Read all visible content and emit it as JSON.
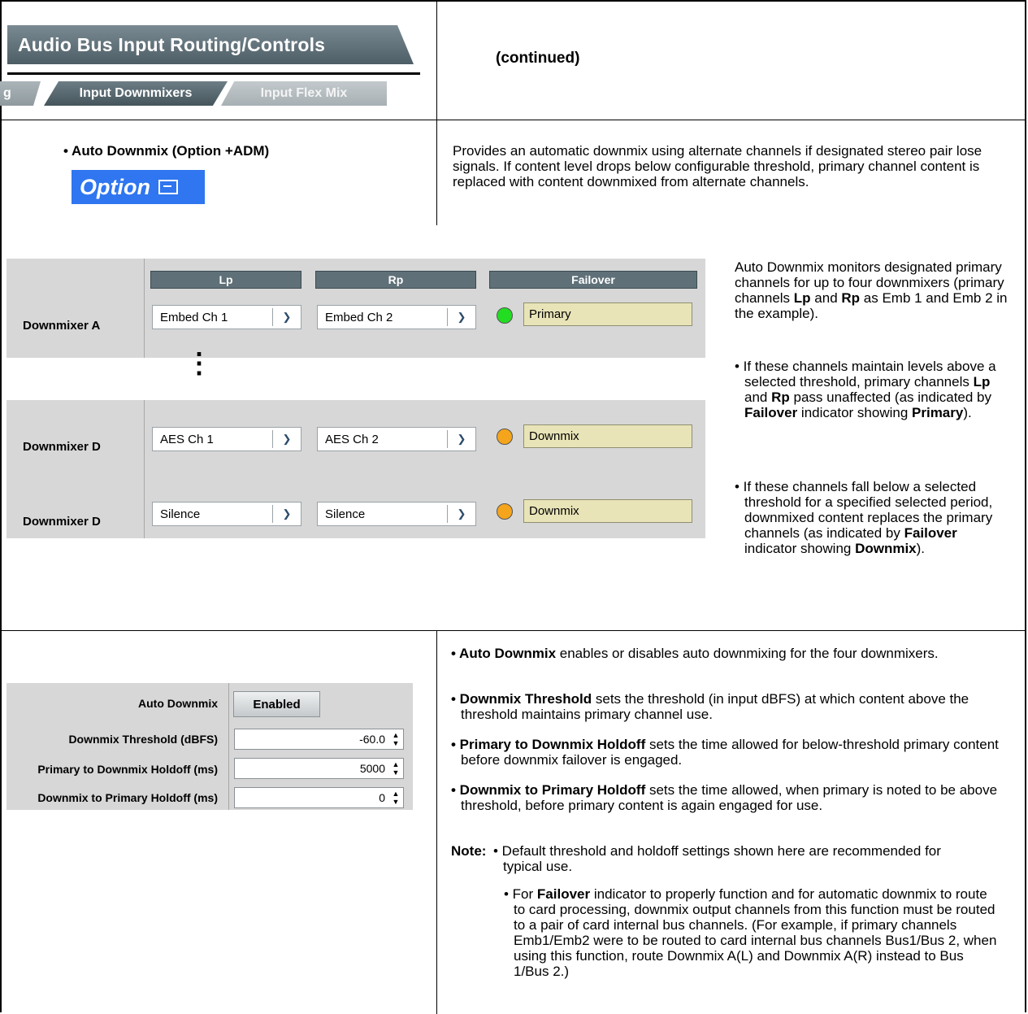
{
  "header": {
    "title": "Audio Bus Input Routing/Controls",
    "tabs": {
      "prev": "g",
      "active": "Input Downmixers",
      "next": "Input Flex Mix"
    },
    "continued": "(continued)"
  },
  "section1": {
    "heading": "• Auto Downmix (Option +ADM)",
    "option_badge": "Option",
    "description": "Provides an automatic downmix using alternate channels if designated stereo pair lose signals. If content level drops below configurable threshold, primary channel content is replaced with content downmixed from alternate channels."
  },
  "downmixers": {
    "columns": {
      "lp": "Lp",
      "rp": "Rp",
      "failover": "Failover"
    },
    "ellipsis": "⋮",
    "rows": [
      {
        "label": "Downmixer A",
        "lp": "Embed Ch 1",
        "rp": "Embed Ch 2",
        "status": "Primary",
        "led_color": "#22dd22"
      },
      {
        "label": "Downmixer D",
        "lp": "AES Ch 1",
        "rp": "AES Ch 2",
        "status": "Downmix",
        "led_color": "#f4a51c"
      },
      {
        "label": "Downmixer D",
        "lp": "Silence",
        "rp": "Silence",
        "status": "Downmix",
        "led_color": "#f4a51c"
      }
    ]
  },
  "side_text": {
    "p1_a": "Auto Downmix monitors designated primary channels for up to four downmixers (primary channels ",
    "lp": "Lp",
    "p1_and": " and ",
    "rp": "Rp",
    "p1_b": " as Emb 1 and Emb 2 in the example).",
    "b1_a": "• If these channels maintain levels above a selected threshold, primary channels ",
    "b1_lp": "Lp",
    "b1_and": " and ",
    "b1_rp": "Rp",
    "b1_b": " pass unaffected (as indicated by ",
    "b1_failover": "Failover",
    "b1_c": " indicator showing ",
    "b1_primary": "Primary",
    "b1_d": ").",
    "b2_a": "• If these channels fall below a selected threshold for a specified selected period, downmixed content replaces the primary channels (as indicated by ",
    "b2_failover": "Failover",
    "b2_b": " indicator showing ",
    "b2_downmix": "Downmix",
    "b2_c": ")."
  },
  "settings": {
    "auto_downmix_label": "Auto Downmix",
    "auto_downmix_value": "Enabled",
    "threshold_label": "Downmix Threshold (dBFS)",
    "threshold_value": "-60.0",
    "p2d_label": "Primary to Downmix Holdoff (ms)",
    "p2d_value": "5000",
    "d2p_label": "Downmix to Primary Holdoff (ms)",
    "d2p_value": "0"
  },
  "notes": {
    "n1_b": "• Auto Downmix",
    "n1": " enables or disables auto downmixing for the four downmixers.",
    "n2_b": "• Downmix Threshold",
    "n2": " sets the threshold (in input dBFS) at which content above the threshold maintains primary channel use.",
    "n3_b": "• Primary to Downmix Holdoff",
    "n3": " sets the time allowed for below-threshold primary content before downmix failover is engaged.",
    "n4_b": "• Downmix to Primary Holdoff",
    "n4": " sets the time allowed, when primary is noted to be above threshold, before primary content is again engaged for use.",
    "note_label": "Note:",
    "note1": "• Default threshold and holdoff settings shown here are recommended for typical use.",
    "note2_a": "• For ",
    "note2_b": "Failover",
    "note2_c": " indicator to properly function and for automatic downmix to route to card processing, downmix output channels from this function must be routed to a pair of card internal bus channels. (For example, if primary channels Emb1/Emb2 were to be routed to card internal bus channels Bus1/Bus 2, when using this function, route Downmix A(L) and Downmix A(R) instead to Bus 1/Bus 2.)"
  }
}
